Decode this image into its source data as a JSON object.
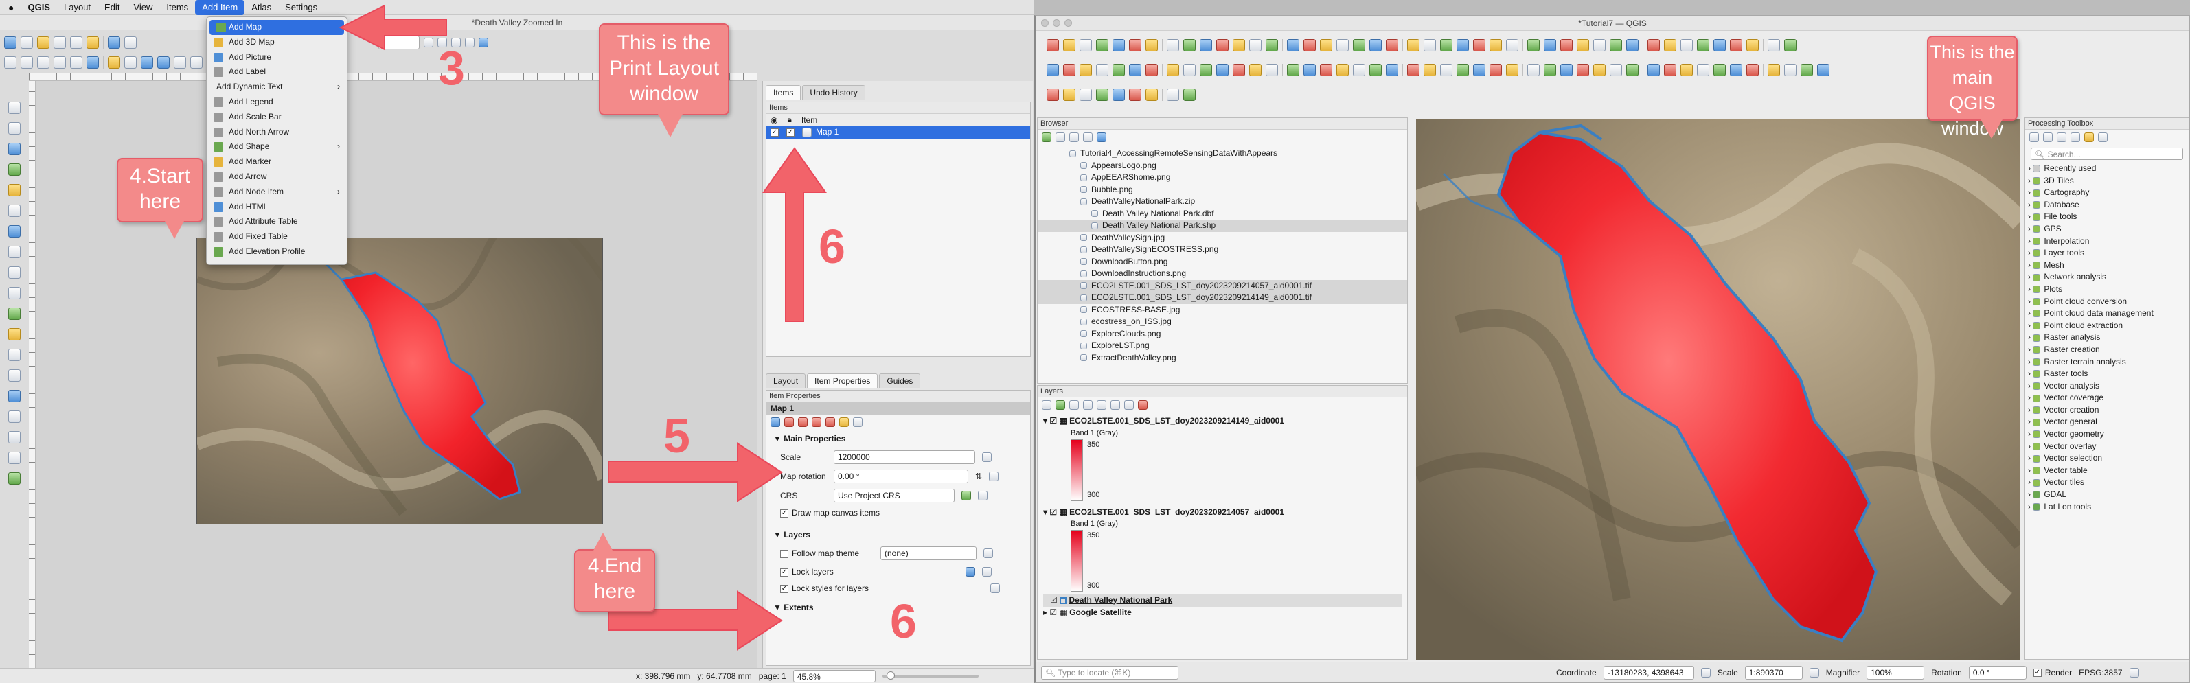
{
  "menubar": {
    "apple": "",
    "app": "QGIS",
    "items": [
      "Layout",
      "Edit",
      "View",
      "Items",
      "Add Item",
      "Atlas",
      "Settings"
    ]
  },
  "layout_window": {
    "title": "*Death Valley Zoomed In",
    "panel_tabs": [
      "Items",
      "Undo History"
    ],
    "items_panel_title": "Items",
    "items_header": "Item",
    "map_item": "Map 1",
    "bottom_tabs": [
      "Layout",
      "Item Properties",
      "Guides"
    ],
    "props_title": "Item Properties",
    "props_item": "Map 1",
    "main_props": "Main Properties",
    "scale_label": "Scale",
    "scale_value": "1200000",
    "rotation_label": "Map rotation",
    "rotation_value": "0.00 °",
    "crs_label": "CRS",
    "crs_value": "Use Project CRS",
    "draw_canvas": "Draw map canvas items",
    "layers_section": "Layers",
    "follow_theme": "Follow map theme",
    "theme_value": "(none)",
    "lock_layers": "Lock layers",
    "lock_styles": "Lock styles for layers",
    "extents_section": "Extents",
    "status_x": "x: 398.796 mm",
    "status_y": "y: 64.7708 mm",
    "status_page": "page: 1",
    "zoom": "45.8%"
  },
  "add_item_menu": [
    {
      "label": "Add Map",
      "submenu": false
    },
    {
      "label": "Add 3D Map",
      "submenu": false
    },
    {
      "label": "Add Picture",
      "submenu": false
    },
    {
      "label": "Add Label",
      "submenu": false
    },
    {
      "label": "Add Dynamic Text",
      "submenu": true
    },
    {
      "label": "Add Legend",
      "submenu": false
    },
    {
      "label": "Add Scale Bar",
      "submenu": false
    },
    {
      "label": "Add North Arrow",
      "submenu": false
    },
    {
      "label": "Add Shape",
      "submenu": true
    },
    {
      "label": "Add Marker",
      "submenu": false
    },
    {
      "label": "Add Arrow",
      "submenu": false
    },
    {
      "label": "Add Node Item",
      "submenu": true
    },
    {
      "label": "Add HTML",
      "submenu": false
    },
    {
      "label": "Add Attribute Table",
      "submenu": false
    },
    {
      "label": "Add Fixed Table",
      "submenu": false
    },
    {
      "label": "Add Elevation Profile",
      "submenu": false
    }
  ],
  "annotations": {
    "print_layout": "This is the Print Layout window",
    "main_qgis": "This is the main QGIS window",
    "start": "4.Start here",
    "end": "4.End here",
    "n3": "3",
    "n5": "5",
    "n6a": "6",
    "n6b": "6"
  },
  "main_window": {
    "title": "*Tutorial7 — QGIS",
    "browser_title": "Browser",
    "browser_items": [
      {
        "label": "Tutorial4_AccessingRemoteSensingDataWithAppears",
        "indent": 1,
        "sel": false
      },
      {
        "label": "AppearsLogo.png",
        "indent": 2,
        "sel": false
      },
      {
        "label": "AppEEARShome.png",
        "indent": 2,
        "sel": false
      },
      {
        "label": "Bubble.png",
        "indent": 2,
        "sel": false
      },
      {
        "label": "DeathValleyNationalPark.zip",
        "indent": 2,
        "sel": false
      },
      {
        "label": "Death Valley National Park.dbf",
        "indent": 3,
        "sel": false
      },
      {
        "label": "Death Valley National Park.shp",
        "indent": 3,
        "sel": true
      },
      {
        "label": "DeathValleySign.jpg",
        "indent": 2,
        "sel": false
      },
      {
        "label": "DeathValleySignECOSTRESS.png",
        "indent": 2,
        "sel": false
      },
      {
        "label": "DownloadButton.png",
        "indent": 2,
        "sel": false
      },
      {
        "label": "DownloadInstructions.png",
        "indent": 2,
        "sel": false
      },
      {
        "label": "ECO2LSTE.001_SDS_LST_doy2023209214057_aid0001.tif",
        "indent": 2,
        "sel": true
      },
      {
        "label": "ECO2LSTE.001_SDS_LST_doy2023209214149_aid0001.tif",
        "indent": 2,
        "sel": true
      },
      {
        "label": "ECOSTRESS-BASE.jpg",
        "indent": 2,
        "sel": false
      },
      {
        "label": "ecostress_on_ISS.jpg",
        "indent": 2,
        "sel": false
      },
      {
        "label": "ExploreClouds.png",
        "indent": 2,
        "sel": false
      },
      {
        "label": "ExploreLST.png",
        "indent": 2,
        "sel": false
      },
      {
        "label": "ExtractDeathValley.png",
        "indent": 2,
        "sel": false
      }
    ],
    "layers_title": "Layers",
    "layer1": "ECO2LSTE.001_SDS_LST_doy2023209214149_aid0001",
    "layer2": "ECO2LSTE.001_SDS_LST_doy2023209214057_aid0001",
    "band": "Band 1 (Gray)",
    "legend_max": "350",
    "legend_min": "300",
    "layer3": "Death Valley National Park",
    "layer4": "Google Satellite",
    "toolbox_title": "Processing Toolbox",
    "toolbox_search": "Search...",
    "toolbox_items": [
      "Recently used",
      "3D Tiles",
      "Cartography",
      "Database",
      "File tools",
      "GPS",
      "Interpolation",
      "Layer tools",
      "Mesh",
      "Network analysis",
      "Plots",
      "Point cloud conversion",
      "Point cloud data management",
      "Point cloud extraction",
      "Raster analysis",
      "Raster creation",
      "Raster terrain analysis",
      "Raster tools",
      "Vector analysis",
      "Vector coverage",
      "Vector creation",
      "Vector general",
      "Vector geometry",
      "Vector overlay",
      "Vector selection",
      "Vector table",
      "Vector tiles",
      "GDAL",
      "Lat Lon tools"
    ],
    "locate_placeholder": "Type to locate (⌘K)",
    "coord_label": "Coordinate",
    "coord_value": "-13180283, 4398643",
    "scale_label": "Scale",
    "scale_value": "1:890370",
    "magnifier_label": "Magnifier",
    "magnifier_value": "100%",
    "rotation_label": "Rotation",
    "rotation_value": "0.0 °",
    "render_label": "Render",
    "crs": "EPSG:3857"
  },
  "colors": {
    "accent": "#2f6fe0",
    "callout": "#f38a8a",
    "arrow": "#f2636a",
    "lst_red": "#f2232b",
    "boundary": "#3a7fc2"
  }
}
